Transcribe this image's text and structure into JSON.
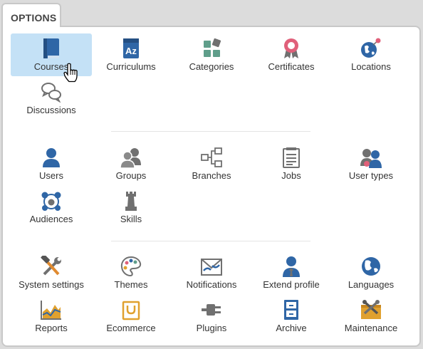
{
  "tab": {
    "label": "OPTIONS"
  },
  "groups": [
    {
      "items": [
        {
          "label": "Courses",
          "icon": "book-icon",
          "selected": true
        },
        {
          "label": "Curriculums",
          "icon": "az-book-icon"
        },
        {
          "label": "Categories",
          "icon": "shapes-icon"
        },
        {
          "label": "Certificates",
          "icon": "ribbon-badge-icon"
        },
        {
          "label": "Locations",
          "icon": "globe-pin-icon"
        },
        {
          "label": "Discussions",
          "icon": "speech-bubbles-icon"
        }
      ]
    },
    {
      "items": [
        {
          "label": "Users",
          "icon": "user-icon"
        },
        {
          "label": "Groups",
          "icon": "group-icon"
        },
        {
          "label": "Branches",
          "icon": "branch-tree-icon"
        },
        {
          "label": "Jobs",
          "icon": "clipboard-icon"
        },
        {
          "label": "User types",
          "icon": "user-types-icon"
        },
        {
          "label": "Audiences",
          "icon": "audience-icon"
        },
        {
          "label": "Skills",
          "icon": "chess-rook-icon"
        }
      ]
    },
    {
      "items": [
        {
          "label": "System settings",
          "icon": "wrench-hammer-icon"
        },
        {
          "label": "Themes",
          "icon": "palette-icon"
        },
        {
          "label": "Notifications",
          "icon": "envelope-icon"
        },
        {
          "label": "Extend profile",
          "icon": "profile-tie-icon"
        },
        {
          "label": "Languages",
          "icon": "earth-icon"
        },
        {
          "label": "Reports",
          "icon": "area-chart-icon"
        },
        {
          "label": "Ecommerce",
          "icon": "cart-bag-icon"
        },
        {
          "label": "Plugins",
          "icon": "plug-icon"
        },
        {
          "label": "Archive",
          "icon": "archive-box-icon"
        },
        {
          "label": "Maintenance",
          "icon": "maintenance-tools-icon"
        }
      ]
    }
  ],
  "colors": {
    "accent_blue": "#2f66a6",
    "icon_gray": "#707070",
    "highlight": "#c4e1f6",
    "pink": "#e0607a",
    "green": "#5f9e8a"
  }
}
